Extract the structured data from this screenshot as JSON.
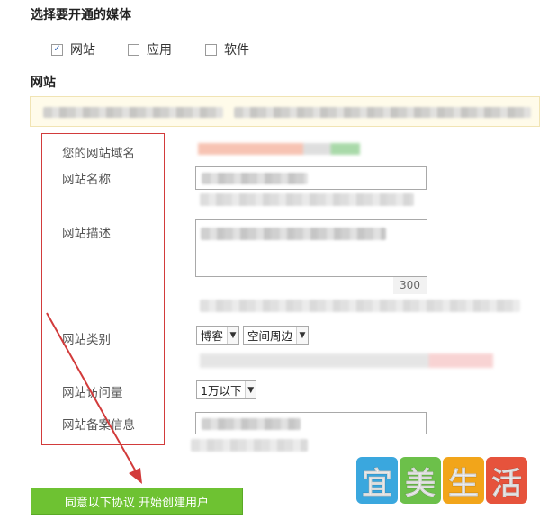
{
  "media_select": {
    "title": "选择要开通的媒体",
    "options": [
      {
        "label": "网站",
        "checked": true
      },
      {
        "label": "应用",
        "checked": false
      },
      {
        "label": "软件",
        "checked": false
      }
    ]
  },
  "website_section": {
    "title": "网站"
  },
  "form": {
    "domain_label": "您的网站域名",
    "name_label": "网站名称",
    "desc_label": "网站描述",
    "desc_counter": "300",
    "category_label": "网站类别",
    "category_primary": "博客",
    "category_secondary": "空间周边",
    "traffic_label": "网站访问量",
    "traffic_value": "1万以下",
    "icp_label": "网站备案信息"
  },
  "submit_button": {
    "label": "同意以下协议 开始创建用户"
  },
  "watermark": {
    "chars": [
      "宜",
      "美",
      "生",
      "活"
    ],
    "colors": [
      "#3aa7de",
      "#6cc04a",
      "#f2a51a",
      "#e6533c"
    ]
  },
  "colors": {
    "accent_green": "#6ec232",
    "annotation_red": "#d23b3b",
    "notice_bg": "#fffbea"
  }
}
